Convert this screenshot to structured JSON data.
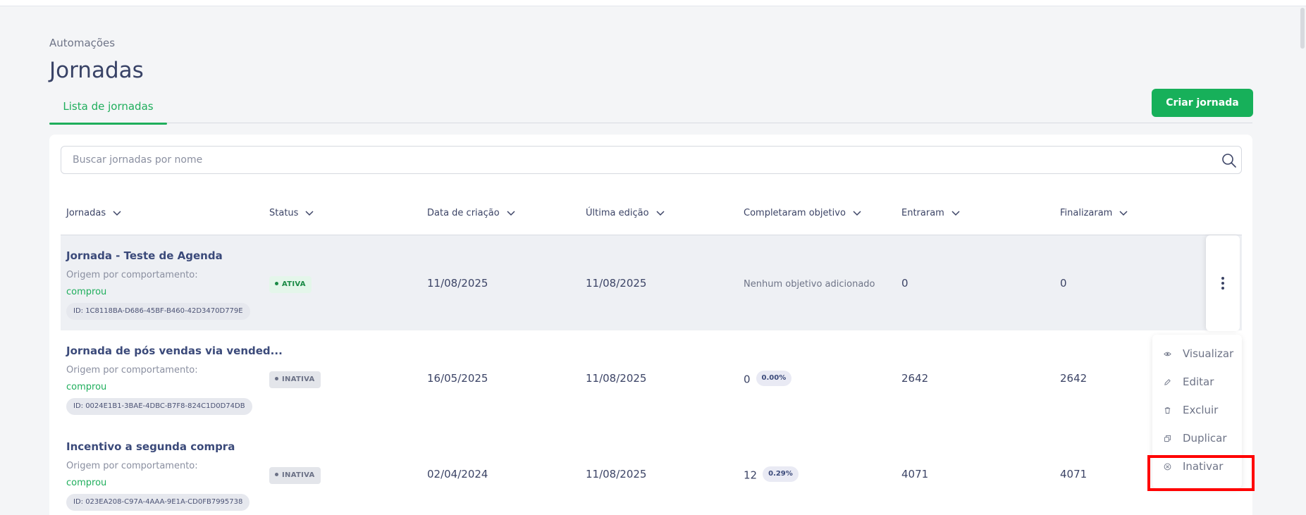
{
  "breadcrumb": "Automações",
  "page_title": "Jornadas",
  "tabs": [
    {
      "label": "Lista de jornadas",
      "active": true
    }
  ],
  "create_button": "Criar jornada",
  "search": {
    "placeholder": "Buscar jornadas por nome",
    "value": ""
  },
  "table": {
    "headers": [
      "Jornadas",
      "Status",
      "Data de criação",
      "Última edição",
      "Completaram objetivo",
      "Entraram",
      "Finalizaram"
    ],
    "rows": [
      {
        "name": "Jornada - Teste de Agenda",
        "origin_label": "Origem por comportamento:",
        "origin_value": "comprou",
        "id": "ID: 1C8118BA-D686-45BF-B460-42D3470D779E",
        "status": "ATIVA",
        "created": "11/08/2025",
        "edited": "11/08/2025",
        "objective": "Nenhum objetivo adicionado",
        "objective_pct": "",
        "entered": "0",
        "finished": "0"
      },
      {
        "name": "Jornada de pós vendas via vended...",
        "origin_label": "Origem por comportamento:",
        "origin_value": "comprou",
        "id": "ID: 0024E1B1-3BAE-4DBC-B7F8-824C1D0D74DB",
        "status": "INATIVA",
        "created": "16/05/2025",
        "edited": "11/08/2025",
        "objective": "0",
        "objective_pct": "0.00%",
        "entered": "2642",
        "finished": "2642"
      },
      {
        "name": "Incentivo a segunda compra",
        "origin_label": "Origem por comportamento:",
        "origin_value": "comprou",
        "id": "ID: 023EA208-C97A-4AAA-9E1A-CD0FB7995738",
        "status": "INATIVA",
        "created": "02/04/2024",
        "edited": "11/08/2025",
        "objective": "12",
        "objective_pct": "0.29%",
        "entered": "4071",
        "finished": "4071"
      }
    ]
  },
  "context_menu": {
    "items": [
      {
        "label": "Visualizar",
        "icon": "eye-icon"
      },
      {
        "label": "Editar",
        "icon": "pencil-icon"
      },
      {
        "label": "Excluir",
        "icon": "trash-icon"
      },
      {
        "label": "Duplicar",
        "icon": "copy-icon"
      },
      {
        "label": "Inativar",
        "icon": "close-circle-icon"
      }
    ]
  },
  "colors": {
    "accent": "#17b05a",
    "title": "#384266",
    "active_badge_bg": "#e4f6ea",
    "inactive_badge_bg": "#e3e5ea",
    "highlight": "#ff0000"
  }
}
